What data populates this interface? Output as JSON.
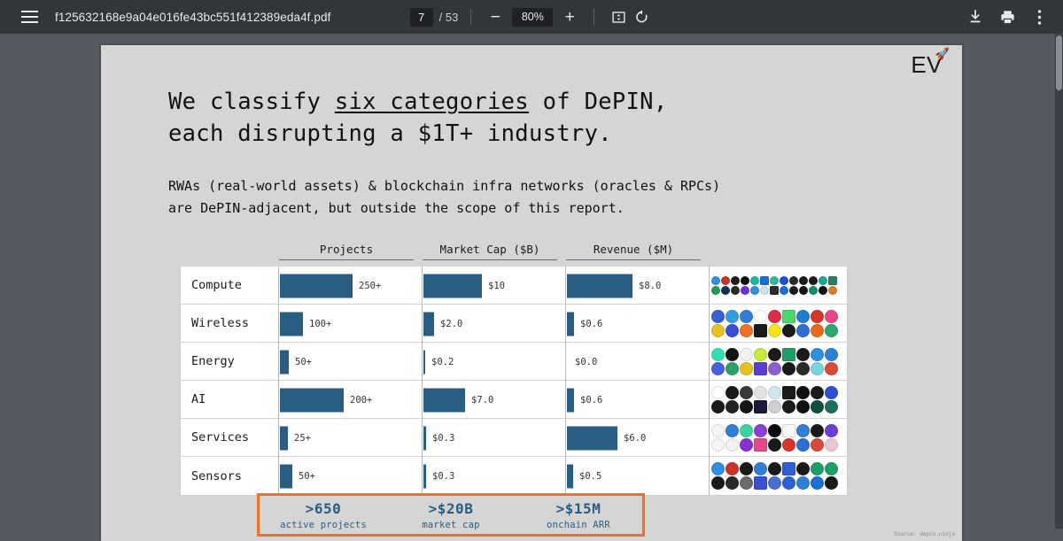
{
  "toolbar": {
    "menu_icon": "hamburger-icon",
    "doc_title": "f125632168e9a04e016fe43bc551f412389eda4f.pdf",
    "page_current": "7",
    "page_total": "/ 53",
    "zoom_out_label": "−",
    "zoom_level": "80%",
    "zoom_in_label": "+",
    "fit_icon": "fit-page-icon",
    "rotate_icon": "rotate-icon",
    "download_icon": "download-icon",
    "print_icon": "print-icon",
    "more_icon": "more-vertical-icon"
  },
  "slide": {
    "brand": "EV",
    "brand_icon": "🚀",
    "title_line1_a": "We classify ",
    "title_line1_u": "six categories",
    "title_line1_b": " of DePIN,",
    "title_line2": "each disrupting a $1T+ industry.",
    "sub_line1": "RWAs (real-world assets) & blockchain infra networks (oracles & RPCs)",
    "sub_line2": "are DePIN-adjacent, but outside the scope of this report.",
    "source": "Source: depin.ninja"
  },
  "chart_data": {
    "type": "bar",
    "title": "We classify six categories of DePIN, each disrupting a $1T+ industry.",
    "grid": false,
    "legend": "none",
    "columns": [
      "Projects",
      "Market Cap ($B)",
      "Revenue ($M)"
    ],
    "categories": [
      "Compute",
      "Wireless",
      "Energy",
      "AI",
      "Services",
      "Sensors"
    ],
    "series": [
      {
        "name": "Projects",
        "labels": [
          "250+",
          "100+",
          "50+",
          "200+",
          "25+",
          "50+"
        ],
        "values": [
          250,
          100,
          50,
          200,
          25,
          50
        ]
      },
      {
        "name": "Market Cap ($B)",
        "labels": [
          "$10",
          "$2.0",
          "$0.2",
          "$7.0",
          "$0.3",
          "$0.3"
        ],
        "values": [
          10,
          2.0,
          0.2,
          7.0,
          0.3,
          0.3
        ]
      },
      {
        "name": "Revenue ($M)",
        "labels": [
          "$8.0",
          "$0.6",
          "$0.0",
          "$0.6",
          "$6.0",
          "$0.5"
        ],
        "values": [
          8.0,
          0.6,
          0.0,
          0.6,
          6.0,
          0.5
        ]
      }
    ],
    "bar_color": "#2a5d82"
  },
  "rows": [
    {
      "category": "Compute",
      "projects_label": "250+",
      "projects_w": 82,
      "mcap_label": "$10",
      "mcap_w": 66,
      "rev_label": "$8.0",
      "rev_w": 74,
      "logo_cols": 13,
      "logo_colors": [
        "#2f8fe0",
        "#c8342a",
        "#1d1d1d",
        "#111111",
        "#14b89a",
        "#1b6fd4",
        "#2fb8a0",
        "#1a4fd6",
        "#2a2a2a",
        "#1b1b1b",
        "#1b1b1b",
        "#18ad8e",
        "#2b7a6a",
        "#1f9d55",
        "#14314f",
        "#2a2a2a",
        "#6b2fd4",
        "#2f8fe0",
        "#cfe3ef",
        "#2b2b2b",
        "#1b6fd4",
        "#1a1a1a",
        "#151515",
        "#0d8f6f",
        "#111111",
        "#d98024"
      ]
    },
    {
      "category": "Wireless",
      "projects_label": "100+",
      "projects_w": 26,
      "mcap_label": "$2.0",
      "mcap_w": 12,
      "rev_label": "$0.6",
      "rev_w": 8,
      "logo_cols": 9,
      "logo_colors": [
        "#3b5fd4",
        "#2f9fe0",
        "#2f7fd4",
        "#ffffff",
        "#e02a4a",
        "#4fd66a",
        "#1b7fd4",
        "#d8342a",
        "#e8488a",
        "#e8c020",
        "#3b4fd4",
        "#f07024",
        "#1a1a1a",
        "#f7e318",
        "#1a1a1a",
        "#2f6fd4",
        "#e86a1a",
        "#2ea86a",
        "#6b3fa0"
      ]
    },
    {
      "category": "Energy",
      "projects_label": "50+",
      "projects_w": 10,
      "mcap_label": "$0.2",
      "mcap_w": 2,
      "rev_label": "$0.0",
      "rev_w": 0,
      "logo_cols": 9,
      "logo_colors": [
        "#2ee0b0",
        "#151515",
        "#f2f2f2",
        "#c8e83a",
        "#1a1a1a",
        "#1fa06a",
        "#1a1a1a",
        "#2f8fe0",
        "#2f7fd4",
        "#4a5fe0",
        "#2ea06a",
        "#e8c020",
        "#5b3fd4",
        "#8b5fd4",
        "#1a1a1a",
        "#2a2a2a",
        "#7ad4e0",
        "#d84a3a"
      ]
    },
    {
      "category": "AI",
      "projects_label": "200+",
      "projects_w": 72,
      "mcap_label": "$7.0",
      "mcap_w": 47,
      "rev_label": "$0.6",
      "rev_w": 8,
      "logo_cols": 9,
      "logo_colors": [
        "#ffffff",
        "#1a1a1a",
        "#3a3a3a",
        "#e2e2e2",
        "#cfe8f0",
        "#1a1a1a",
        "#111111",
        "#1b1b1b",
        "#2f4fd4",
        "#1a1a1a",
        "#222222",
        "#151515",
        "#1a1a3a",
        "#cfcfcf",
        "#1a1a1a",
        "#111111",
        "#0e4f3f",
        "#1b6f5f"
      ]
    },
    {
      "category": "Services",
      "projects_label": "25+",
      "projects_w": 9,
      "mcap_label": "$0.3",
      "mcap_w": 3,
      "rev_label": "$6.0",
      "rev_w": 57,
      "logo_cols": 9,
      "logo_colors": [
        "#f5f5f5",
        "#2f7fd4",
        "#3ad4a0",
        "#8b3fd4",
        "#0a0a0a",
        "#f5f5f5",
        "#2f7fd4",
        "#1a1a1a",
        "#6b3fd4",
        "#f5f5f5",
        "#f2f2f2",
        "#8b2fd4",
        "#e8488a",
        "#1a1a1a",
        "#d8342a",
        "#2f6fd4",
        "#d84a3a",
        "#e8c8d4"
      ]
    },
    {
      "category": "Sensors",
      "projects_label": "50+",
      "projects_w": 14,
      "mcap_label": "$0.3",
      "mcap_w": 3,
      "rev_label": "$0.5",
      "rev_w": 7,
      "logo_cols": 9,
      "logo_colors": [
        "#2f8fe0",
        "#c8342a",
        "#1a1a1a",
        "#2f7fd4",
        "#1a1a1a",
        "#2f5fd4",
        "#1a1a1a",
        "#1b9f6a",
        "#1fa06a",
        "#1a1a1a",
        "#2a2a2a",
        "#6a6a6a",
        "#3a4fd4",
        "#4a6fd4",
        "#2f5fd4",
        "#2f7fd4",
        "#1b6fd4",
        "#1a1a1a"
      ]
    }
  ],
  "summary": {
    "items": [
      {
        "big": ">650",
        "small": "active projects"
      },
      {
        "big": ">$20B",
        "small": "market cap"
      },
      {
        "big": ">$15M",
        "small": "onchain ARR"
      }
    ],
    "border_color": "#f07024",
    "text_color": "#2a5d82"
  }
}
